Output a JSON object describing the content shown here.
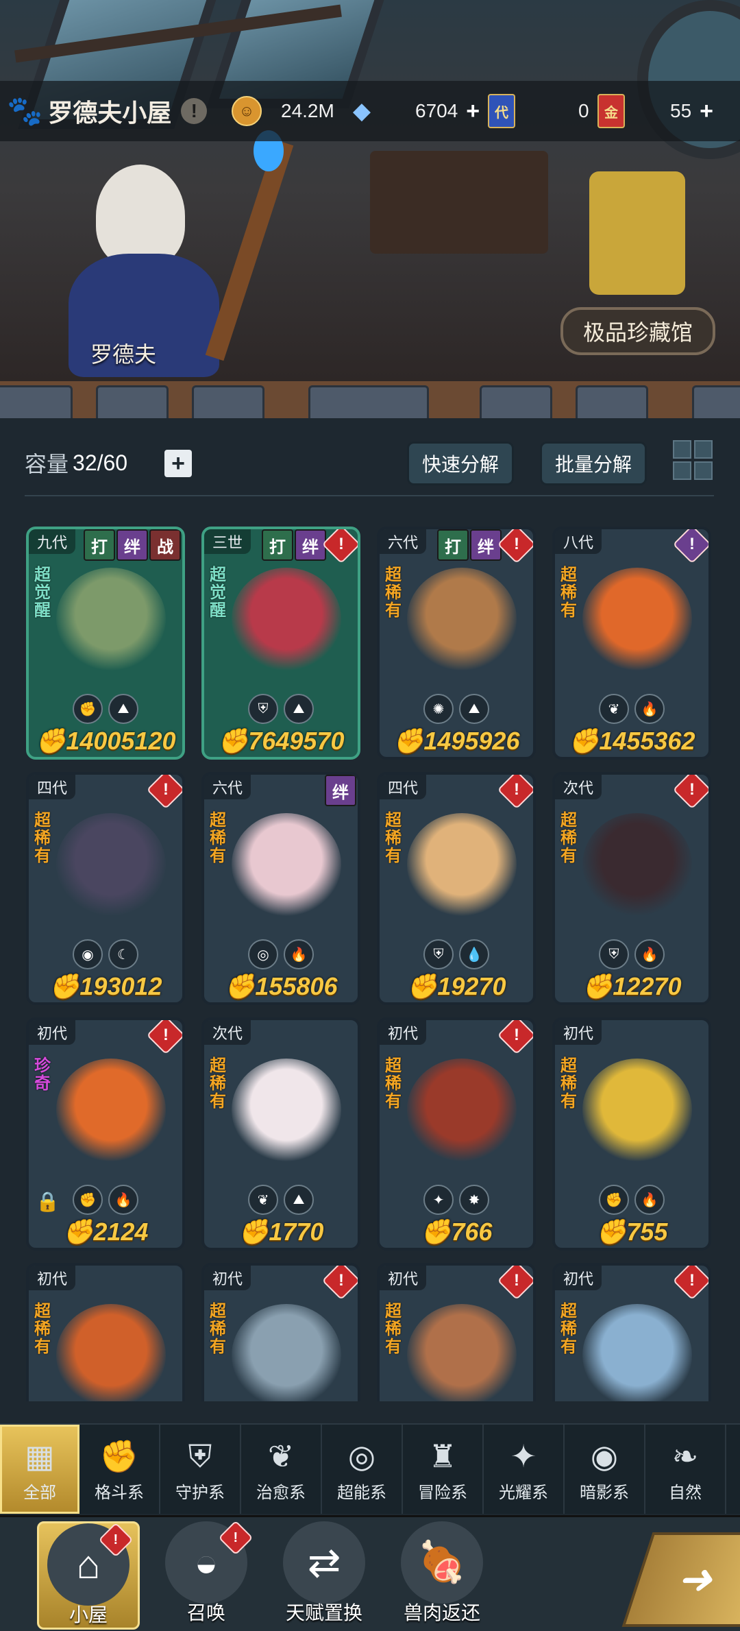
{
  "header": {
    "title": "罗德夫小屋",
    "info_icon": "exclamation-icon",
    "resources": [
      {
        "icon": "gold-coin-icon",
        "value": "24.2M",
        "color": "#e0a03a"
      },
      {
        "icon": "crystal-icon",
        "value": "6704",
        "plus": "+",
        "color": "#7ab0ff"
      },
      {
        "icon": "dai-card-icon",
        "label": "代",
        "value": "0",
        "color": "#2f53b8"
      },
      {
        "icon": "jin-card-icon",
        "label": "金",
        "value": "55",
        "plus": "+",
        "color": "#c8322f"
      }
    ]
  },
  "scene": {
    "npc_name": "罗德夫",
    "museum_button": "极品珍藏馆"
  },
  "storage": {
    "label": "容量",
    "value": "32/60",
    "plus": "+",
    "quick_decompose": "快速分解",
    "batch_decompose": "批量分解"
  },
  "pets": [
    {
      "gen": "九代",
      "tags": [
        "打",
        "绊",
        "战"
      ],
      "alert": false,
      "rarity": "超觉醒",
      "rarity_type": "awake",
      "elements": [
        "✊",
        "⛰"
      ],
      "power": "14005120",
      "style": "green",
      "art": "#7d9a6a"
    },
    {
      "gen": "三世",
      "tags": [
        "打",
        "绊"
      ],
      "alert": true,
      "rarity": "超觉醒",
      "rarity_type": "awake",
      "elements": [
        "⛨",
        "⛰"
      ],
      "power": "7649570",
      "style": "green",
      "art": "#b83a4a"
    },
    {
      "gen": "六代",
      "tags": [
        "打",
        "绊"
      ],
      "alert": true,
      "rarity": "超稀有",
      "rarity_type": "super",
      "elements": [
        "✺",
        "⛰"
      ],
      "power": "1495926",
      "style": "blue",
      "art": "#b07a4a"
    },
    {
      "gen": "八代",
      "tags": [],
      "alert": true,
      "alert_purple": true,
      "rarity": "超稀有",
      "rarity_type": "super",
      "elements": [
        "❦",
        "🔥"
      ],
      "power": "1455362",
      "style": "blue",
      "art": "#e0682a"
    },
    {
      "gen": "四代",
      "tags": [],
      "alert": true,
      "rarity": "超稀有",
      "rarity_type": "super",
      "elements": [
        "◉",
        "☾"
      ],
      "power": "193012",
      "style": "blue",
      "art": "#4a4660"
    },
    {
      "gen": "六代",
      "tags": [
        "绊"
      ],
      "alert": false,
      "rarity": "超稀有",
      "rarity_type": "super",
      "elements": [
        "◎",
        "🔥"
      ],
      "power": "155806",
      "style": "blue",
      "art": "#e8c8d0"
    },
    {
      "gen": "四代",
      "tags": [],
      "alert": true,
      "rarity": "超稀有",
      "rarity_type": "super",
      "elements": [
        "⛨",
        "💧"
      ],
      "power": "19270",
      "style": "blue",
      "art": "#e0b27a"
    },
    {
      "gen": "次代",
      "tags": [],
      "alert": true,
      "rarity": "超稀有",
      "rarity_type": "super",
      "elements": [
        "⛨",
        "🔥"
      ],
      "power": "12270",
      "style": "blue",
      "art": "#3a2a30"
    },
    {
      "gen": "初代",
      "tags": [],
      "alert": true,
      "rarity": "珍奇",
      "rarity_type": "rare",
      "elements": [
        "✊",
        "🔥"
      ],
      "power": "2124",
      "style": "blue",
      "art": "#e06a2a",
      "locked": true
    },
    {
      "gen": "次代",
      "tags": [],
      "alert": false,
      "rarity": "超稀有",
      "rarity_type": "super",
      "elements": [
        "❦",
        "⛰"
      ],
      "power": "1770",
      "style": "blue",
      "art": "#f0e6ea"
    },
    {
      "gen": "初代",
      "tags": [],
      "alert": true,
      "rarity": "超稀有",
      "rarity_type": "super",
      "elements": [
        "✦",
        "✸"
      ],
      "power": "766",
      "style": "blue",
      "art": "#9a3a2a"
    },
    {
      "gen": "初代",
      "tags": [],
      "alert": false,
      "rarity": "超稀有",
      "rarity_type": "super",
      "elements": [
        "✊",
        "🔥"
      ],
      "power": "755",
      "style": "blue",
      "art": "#e0b83a"
    },
    {
      "gen": "初代",
      "tags": [],
      "alert": false,
      "rarity": "超稀有",
      "rarity_type": "super",
      "elements": [],
      "power": "",
      "style": "blue",
      "art": "#d0602a"
    },
    {
      "gen": "初代",
      "tags": [],
      "alert": true,
      "rarity": "超稀有",
      "rarity_type": "super",
      "elements": [],
      "power": "",
      "style": "blue",
      "art": "#8aa0b0"
    },
    {
      "gen": "初代",
      "tags": [],
      "alert": true,
      "rarity": "超稀有",
      "rarity_type": "super",
      "elements": [],
      "power": "",
      "style": "blue",
      "art": "#b0704a"
    },
    {
      "gen": "初代",
      "tags": [],
      "alert": true,
      "rarity": "超稀有",
      "rarity_type": "super",
      "elements": [],
      "power": "",
      "style": "blue",
      "art": "#8ab0d0"
    }
  ],
  "filter_tabs": [
    {
      "label": "全部",
      "icon": "all-icon",
      "glyph": "▦",
      "active": true
    },
    {
      "label": "格斗系",
      "icon": "fist-icon",
      "glyph": "✊"
    },
    {
      "label": "守护系",
      "icon": "shield-icon",
      "glyph": "⛨"
    },
    {
      "label": "治愈系",
      "icon": "sprout-icon",
      "glyph": "❦"
    },
    {
      "label": "超能系",
      "icon": "alien-icon",
      "glyph": "◎"
    },
    {
      "label": "冒险系",
      "icon": "lantern-icon",
      "glyph": "♜"
    },
    {
      "label": "光耀系",
      "icon": "star-icon",
      "glyph": "✦"
    },
    {
      "label": "暗影系",
      "icon": "eye-icon",
      "glyph": "◉"
    },
    {
      "label": "自然",
      "icon": "leaf-icon",
      "glyph": "❧"
    }
  ],
  "bottom_nav": [
    {
      "label": "小屋",
      "icon": "house-icon",
      "glyph": "⌂",
      "active": true,
      "badge": true
    },
    {
      "label": "召唤",
      "icon": "egg-icon",
      "glyph": "◒",
      "badge": true
    },
    {
      "label": "天赋置换",
      "icon": "swap-icon",
      "glyph": "⇄"
    },
    {
      "label": "兽肉返还",
      "icon": "meat-icon",
      "glyph": "🍖"
    }
  ],
  "go_button_icon": "arrow-right-icon"
}
